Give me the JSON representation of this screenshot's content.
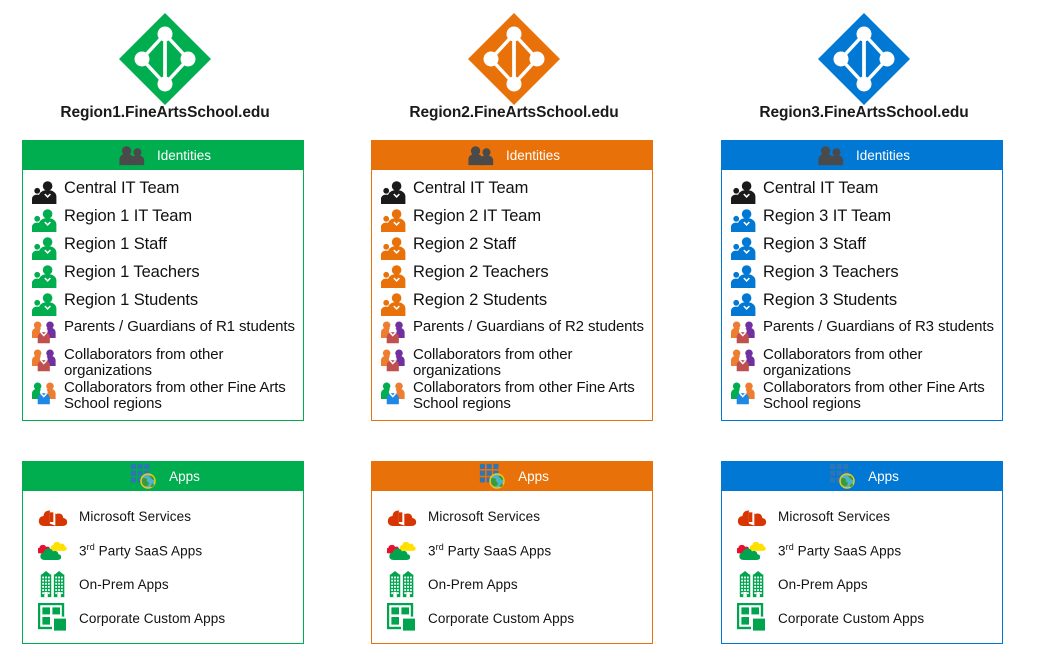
{
  "diagram": {
    "title": "Fine Arts School multi-tenant Azure AD identity and apps diagram",
    "columns": [
      {
        "tenant_name": "Region1.FineArtsSchool.edu",
        "accent_color": "#00AD4F",
        "logo_icon": "azure-ad-logo-icon",
        "identities": {
          "header_label": "Identities",
          "header_icon": "identities-people-icon",
          "items": [
            {
              "label": "Central IT Team",
              "icon": "people-pair-icon",
              "icon_color": "#1a1a1a"
            },
            {
              "label": "Region 1 IT Team",
              "icon": "people-pair-icon",
              "icon_color": "#00AD4F"
            },
            {
              "label": "Region 1 Staff",
              "icon": "people-pair-icon",
              "icon_color": "#00AD4F"
            },
            {
              "label": "Region 1 Teachers",
              "icon": "people-pair-icon",
              "icon_color": "#00AD4F"
            },
            {
              "label": "Region 1 Students",
              "icon": "people-pair-icon",
              "icon_color": "#00AD4F"
            },
            {
              "label": "Parents / Guardians of R1 students",
              "icon": "people-group-external-icon",
              "icon_color": "#E8710A"
            },
            {
              "label": "Collaborators from other organizations",
              "icon": "people-group-external-icon",
              "icon_color": "#E8710A"
            },
            {
              "label": "Collaborators from other Fine Arts School regions",
              "icon": "people-group-regions-icon",
              "icon_color": "#00AD4F"
            }
          ]
        },
        "apps": {
          "header_label": "Apps",
          "header_icon": "apps-globe-grid-icon",
          "items": [
            {
              "label": "Microsoft Services",
              "icon": "office-cloud-icon"
            },
            {
              "label": "3rd Party SaaS Apps",
              "label_prefix": "3",
              "label_sup": "rd",
              "label_rest": " Party SaaS Apps",
              "icon": "saas-clouds-icon"
            },
            {
              "label": "On-Prem Apps",
              "icon": "buildings-icon"
            },
            {
              "label": "Corporate Custom Apps",
              "icon": "custom-app-window-icon"
            }
          ]
        }
      },
      {
        "tenant_name": "Region2.FineArtsSchool.edu",
        "accent_color": "#E8710A",
        "logo_icon": "azure-ad-logo-icon",
        "identities": {
          "header_label": "Identities",
          "header_icon": "identities-people-icon",
          "items": [
            {
              "label": "Central IT Team",
              "icon": "people-pair-icon",
              "icon_color": "#1a1a1a"
            },
            {
              "label": "Region 2 IT Team",
              "icon": "people-pair-icon",
              "icon_color": "#E8710A"
            },
            {
              "label": "Region 2 Staff",
              "icon": "people-pair-icon",
              "icon_color": "#E8710A"
            },
            {
              "label": "Region 2 Teachers",
              "icon": "people-pair-icon",
              "icon_color": "#E8710A"
            },
            {
              "label": "Region 2 Students",
              "icon": "people-pair-icon",
              "icon_color": "#E8710A"
            },
            {
              "label": "Parents / Guardians of R2 students",
              "icon": "people-group-external-icon",
              "icon_color": "#E8710A"
            },
            {
              "label": "Collaborators from other organizations",
              "icon": "people-group-external-icon",
              "icon_color": "#E8710A"
            },
            {
              "label": "Collaborators from other Fine Arts School regions",
              "icon": "people-group-regions-icon",
              "icon_color": "#00AD4F"
            }
          ]
        },
        "apps": {
          "header_label": "Apps",
          "header_icon": "apps-globe-grid-icon",
          "items": [
            {
              "label": "Microsoft Services",
              "icon": "office-cloud-icon"
            },
            {
              "label": "3rd Party SaaS Apps",
              "label_prefix": "3",
              "label_sup": "rd",
              "label_rest": " Party SaaS Apps",
              "icon": "saas-clouds-icon"
            },
            {
              "label": "On-Prem Apps",
              "icon": "buildings-icon"
            },
            {
              "label": "Corporate Custom Apps",
              "icon": "custom-app-window-icon"
            }
          ]
        }
      },
      {
        "tenant_name": "Region3.FineArtsSchool.edu",
        "accent_color": "#0078D4",
        "logo_icon": "azure-ad-logo-icon",
        "identities": {
          "header_label": "Identities",
          "header_icon": "identities-people-icon",
          "items": [
            {
              "label": "Central IT Team",
              "icon": "people-pair-icon",
              "icon_color": "#1a1a1a"
            },
            {
              "label": "Region 3 IT Team",
              "icon": "people-pair-icon",
              "icon_color": "#0078D4"
            },
            {
              "label": "Region 3 Staff",
              "icon": "people-pair-icon",
              "icon_color": "#0078D4"
            },
            {
              "label": "Region 3 Teachers",
              "icon": "people-pair-icon",
              "icon_color": "#0078D4"
            },
            {
              "label": "Region 3 Students",
              "icon": "people-pair-icon",
              "icon_color": "#0078D4"
            },
            {
              "label": "Parents / Guardians of R3 students",
              "icon": "people-group-external-icon",
              "icon_color": "#E8710A"
            },
            {
              "label": "Collaborators from other organizations",
              "icon": "people-group-external-icon",
              "icon_color": "#E8710A"
            },
            {
              "label": "Collaborators from other Fine Arts School regions",
              "icon": "people-group-regions-icon",
              "icon_color": "#00AD4F"
            }
          ]
        },
        "apps": {
          "header_label": "Apps",
          "header_icon": "apps-globe-grid-icon",
          "items": [
            {
              "label": "Microsoft Services",
              "icon": "office-cloud-icon"
            },
            {
              "label": "3rd Party SaaS Apps",
              "label_prefix": "3",
              "label_sup": "rd",
              "label_rest": " Party SaaS Apps",
              "icon": "saas-clouds-icon"
            },
            {
              "label": "On-Prem Apps",
              "icon": "buildings-icon"
            },
            {
              "label": "Corporate Custom Apps",
              "icon": "custom-app-window-icon"
            }
          ]
        }
      }
    ]
  },
  "colors": {
    "green": "#00AD4F",
    "orange": "#E8710A",
    "blue": "#0078D4",
    "dark": "#1a1a1a",
    "purple": "#7030A0",
    "red": "#E8112D",
    "yellow": "#FFE000",
    "office_red": "#D73502",
    "text": "#111111"
  }
}
